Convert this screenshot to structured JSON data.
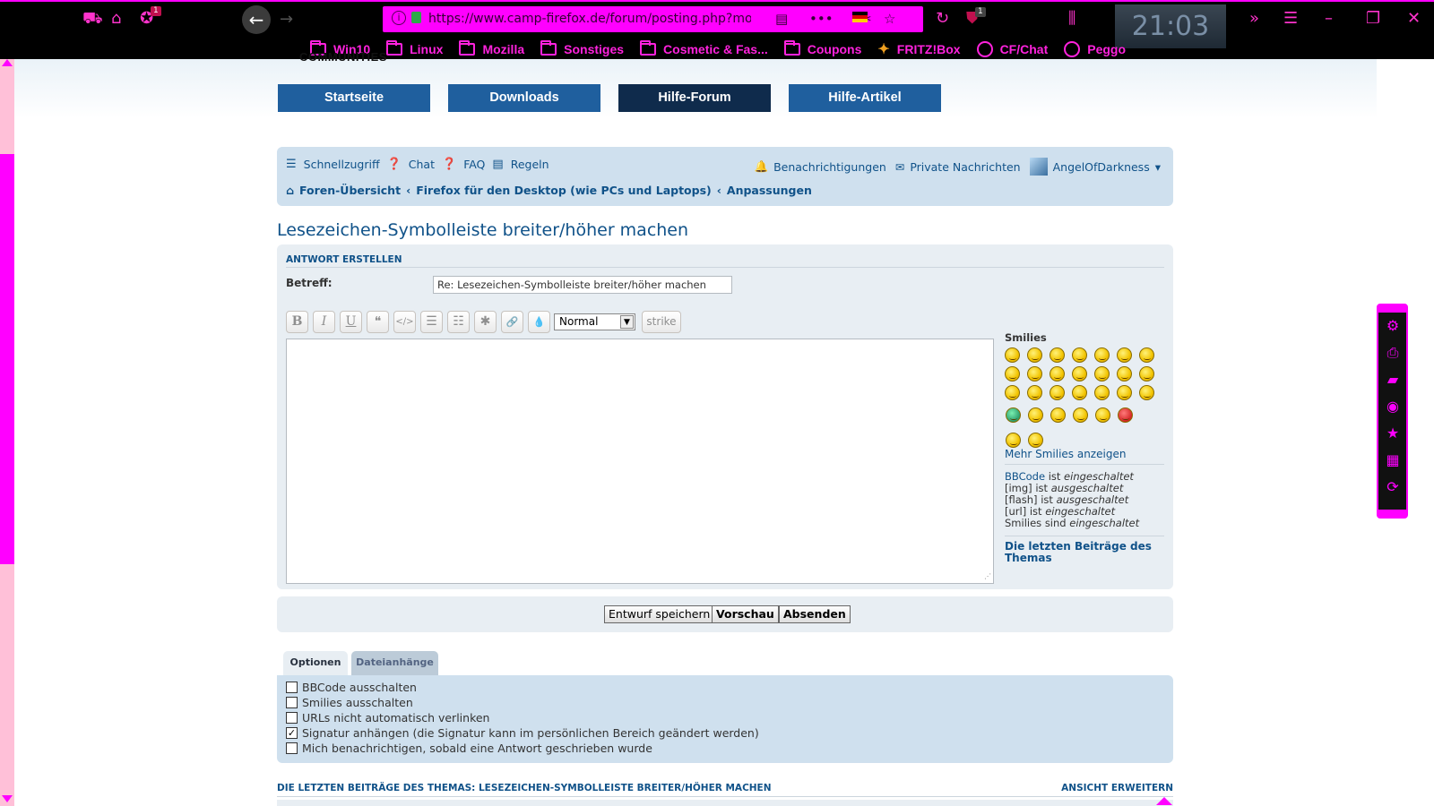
{
  "browser": {
    "url": "https://www.camp-firefox.de/forum/posting.php?mode=re",
    "clock": "21:03",
    "badges": {
      "addon": "1",
      "ublock": "1"
    },
    "bookmarks": [
      {
        "label": "Win10",
        "icon": "folder-icon"
      },
      {
        "label": "Linux",
        "icon": "folder-icon"
      },
      {
        "label": "Mozilla",
        "icon": "folder-icon"
      },
      {
        "label": "Sonstiges",
        "icon": "folder-icon"
      },
      {
        "label": "Cosmetic & Fas...",
        "icon": "folder-icon"
      },
      {
        "label": "Coupons",
        "icon": "folder-icon"
      },
      {
        "label": "FRITZ!Box",
        "icon": "fritzbox-icon"
      },
      {
        "label": "CF/Chat",
        "icon": "globe-icon"
      },
      {
        "label": "Peggo",
        "icon": "globe-icon"
      }
    ],
    "accent_color": "#ff00ff"
  },
  "site": {
    "communities_label": "COMMUNITIES",
    "nav": [
      {
        "label": "Startseite",
        "active": false
      },
      {
        "label": "Downloads",
        "active": false
      },
      {
        "label": "Hilfe-Forum",
        "active": true
      },
      {
        "label": "Hilfe-Artikel",
        "active": false
      }
    ]
  },
  "forum_nav": {
    "quick_links": [
      {
        "label": "Schnellzugriff",
        "icon": "menu-icon"
      },
      {
        "label": "Chat",
        "icon": "question-icon"
      },
      {
        "label": "FAQ",
        "icon": "question-icon"
      },
      {
        "label": "Regeln",
        "icon": "book-icon"
      }
    ],
    "notifications": "Benachrichtigungen",
    "private_messages": "Private Nachrichten",
    "username": "AngelOfDarkness",
    "breadcrumbs": [
      "Foren-Übersicht",
      "Firefox für den Desktop (wie PCs und Laptops)",
      "Anpassungen"
    ],
    "breadcrumb_sep": "‹"
  },
  "topic_title": "Lesezeichen-Symbolleiste breiter/höher machen",
  "posting": {
    "section_header": "ANTWORT ERSTELLEN",
    "subject_label": "Betreff:",
    "subject_value": "Re: Lesezeichen-Symbolleiste breiter/höher machen",
    "toolbar": {
      "bold": "B",
      "italic": "I",
      "underline": "U",
      "quote": "❝",
      "code": "</>",
      "list": "☰",
      "list_num": "☷",
      "list_item": "✱",
      "link": "🔗",
      "color": "💧",
      "font_size": "Normal",
      "strike": "strike"
    },
    "message_value": "",
    "smilies_title": "Smilies",
    "more_smilies": "Mehr Smilies anzeigen",
    "bbinfo": {
      "bbcode_link": "BBCode",
      "is": "ist",
      "bbcode_state": "eingeschaltet",
      "img": "[img]",
      "img_state": "ausgeschaltet",
      "flash": "[flash]",
      "flash_state": "ausgeschaltet",
      "url": "[url]",
      "url_state": "eingeschaltet",
      "smilies": "Smilies",
      "sind": "sind",
      "smilies_state": "eingeschaltet"
    },
    "last_posts_link": "Die letzten Beiträge des Themas"
  },
  "submit": {
    "save_draft": "Entwurf speichern",
    "preview": "Vorschau",
    "send": "Absenden"
  },
  "options": {
    "tabs": [
      {
        "label": "Optionen",
        "active": true
      },
      {
        "label": "Dateianhänge",
        "active": false
      }
    ],
    "items": [
      {
        "label": "BBCode ausschalten",
        "checked": false
      },
      {
        "label": "Smilies ausschalten",
        "checked": false
      },
      {
        "label": "URLs nicht automatisch verlinken",
        "checked": false
      },
      {
        "label": "Signatur anhängen (die Signatur kann im persönlichen Bereich geändert werden)",
        "checked": true
      },
      {
        "label": "Mich benachrichtigen, sobald eine Antwort geschrieben wurde",
        "checked": false
      }
    ]
  },
  "topic_review": {
    "header": "DIE LETZTEN BEITRÄGE DES THEMAS: LESEZEICHEN-SYMBOLLEISTE BREITER/HÖHER MACHEN",
    "expand": "ANSICHT ERWEITERN"
  }
}
